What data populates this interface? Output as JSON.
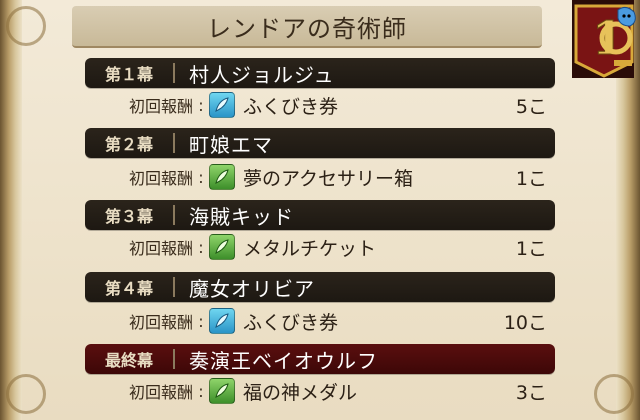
{
  "title": "レンドアの奇術師",
  "badge": {
    "number": "10"
  },
  "reward_label": "初回報酬",
  "colon": ":",
  "chapters": [
    {
      "act": "第１幕",
      "name": "村人ジョルジュ",
      "item": "ふくびき券",
      "count": "5こ",
      "icon": "blue-feather-icon",
      "final": false
    },
    {
      "act": "第２幕",
      "name": "町娘エマ",
      "item": "夢のアクセサリー箱",
      "count": "1こ",
      "icon": "green-feather-icon",
      "final": false
    },
    {
      "act": "第３幕",
      "name": "海賊キッド",
      "item": "メタルチケット",
      "count": "1こ",
      "icon": "green-feather-icon",
      "final": false
    },
    {
      "act": "第４幕",
      "name": "魔女オリビア",
      "item": "ふくびき券",
      "count": "10こ",
      "icon": "blue-feather-icon",
      "final": false
    },
    {
      "act": "最終幕",
      "name": "奏演王ベイオウルフ",
      "item": "福の神メダル",
      "count": "3こ",
      "icon": "green-feather-icon",
      "final": true
    }
  ],
  "colors": {
    "header_dark": "#1d1812",
    "header_final": "#3d0707",
    "parchment": "#eee3cc"
  }
}
